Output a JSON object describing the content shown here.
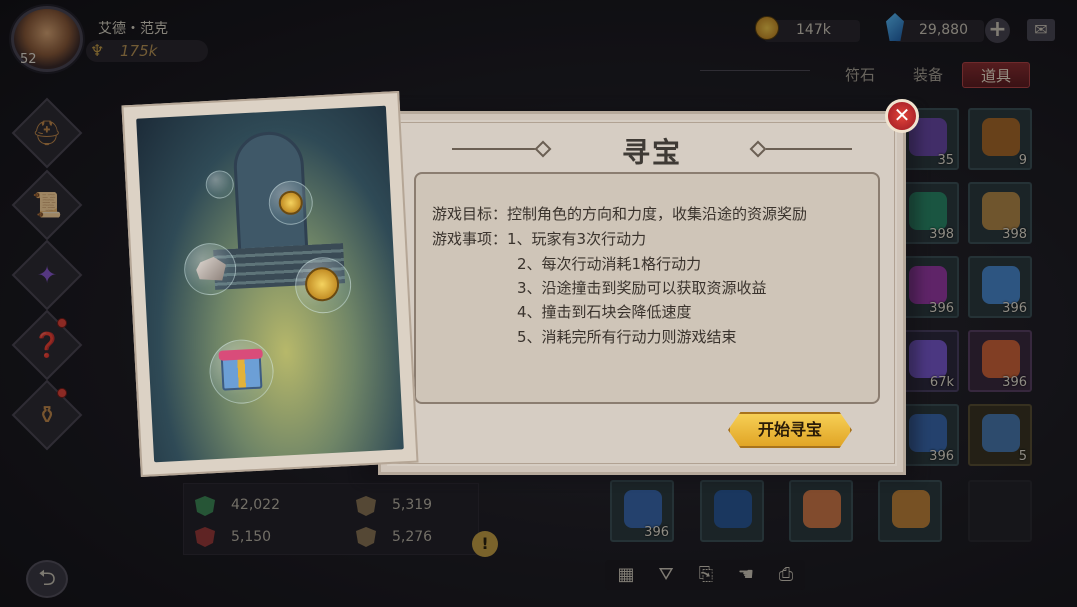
{
  "player": {
    "name": "艾德・范克",
    "level": "52",
    "power": "175k"
  },
  "currency": {
    "gold": "147k",
    "gems": "29,880"
  },
  "tabs": [
    {
      "label": "符石"
    },
    {
      "label": "装备"
    },
    {
      "label": "道具"
    }
  ],
  "stats": [
    {
      "value": "42,022"
    },
    {
      "value": "5,319"
    },
    {
      "value": "5,150"
    },
    {
      "value": "5,276"
    }
  ],
  "inventory_counts": [
    "35",
    "9",
    "398",
    "398",
    "396",
    "396",
    "67k",
    "396",
    "396",
    "5",
    "396"
  ],
  "dialog": {
    "title": "寻宝",
    "lines": [
      "游戏目标：控制角色的方向和力度，收集沿途的资源奖励",
      "游戏事项：1、玩家有3次行动力",
      "2、每次行动消耗1格行动力",
      "3、沿途撞击到奖励可以获取资源收益",
      "4、撞击到石块会降低速度",
      "5、消耗完所有行动力则游戏结束"
    ],
    "start_label": "开始寻宝"
  },
  "icons": {
    "close": "close-icon",
    "back": "back-arrow-icon",
    "plus": "plus-icon",
    "mail": "mail-icon"
  },
  "colors": {
    "accent_gold": "#e1a526",
    "close_red": "#b0262a",
    "active_tab": "#8a2f32"
  }
}
